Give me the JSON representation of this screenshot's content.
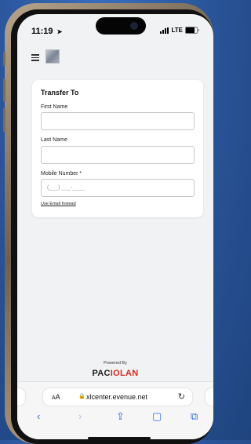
{
  "status_bar": {
    "time": "11:19",
    "network": "LTE",
    "battery_level": 0.8
  },
  "header": {
    "menu_icon": "hamburger-menu-icon",
    "logo_icon": "venue-logo-icon"
  },
  "form": {
    "title": "Transfer To",
    "first_name_label": "First Name",
    "first_name_value": "",
    "last_name_label": "Last Name",
    "last_name_value": "",
    "mobile_label": "Mobile Number *",
    "mobile_placeholder": "(___) ___-____",
    "alt_link": "Use Email Instead"
  },
  "footer": {
    "powered_by": "Powered By",
    "brand_part1": "PAC",
    "brand_part2": "IOLAN",
    "brand_accent_color": "#d52b1e"
  },
  "browser": {
    "text_size_label": "AA",
    "url": "xlcenter.evenue.net",
    "icons": [
      "lock-icon",
      "reload-icon",
      "back-icon",
      "forward-icon",
      "share-icon",
      "bookmarks-icon",
      "tabs-icon"
    ]
  }
}
